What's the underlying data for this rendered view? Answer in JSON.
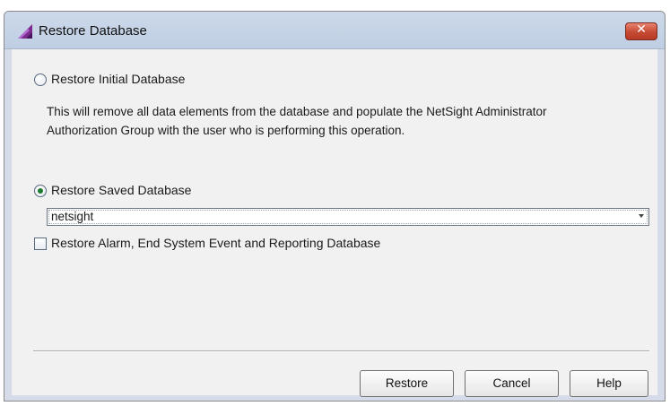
{
  "window": {
    "title": "Restore Database",
    "close_symbol": "✕",
    "icon": "app-icon"
  },
  "options": {
    "initial": {
      "label": "Restore Initial Database",
      "selected": false,
      "description_lines": [
        "This will remove all data elements from the database and populate the NetSight Administrator",
        "Authorization Group with the user who is performing this operation."
      ]
    },
    "saved": {
      "label": "Restore Saved Database",
      "selected": true,
      "database_value": "netsight"
    }
  },
  "alarm_checkbox": {
    "label": "Restore Alarm, End System Event and Reporting Database",
    "checked": false
  },
  "buttons": {
    "restore": "Restore",
    "cancel": "Cancel",
    "help": "Help"
  },
  "colors": {
    "window_frame": "#d6dbe9",
    "content_bg": "#f1f1f1",
    "close_button": "#c54a34",
    "radio_selected": "#1f7a2e"
  }
}
